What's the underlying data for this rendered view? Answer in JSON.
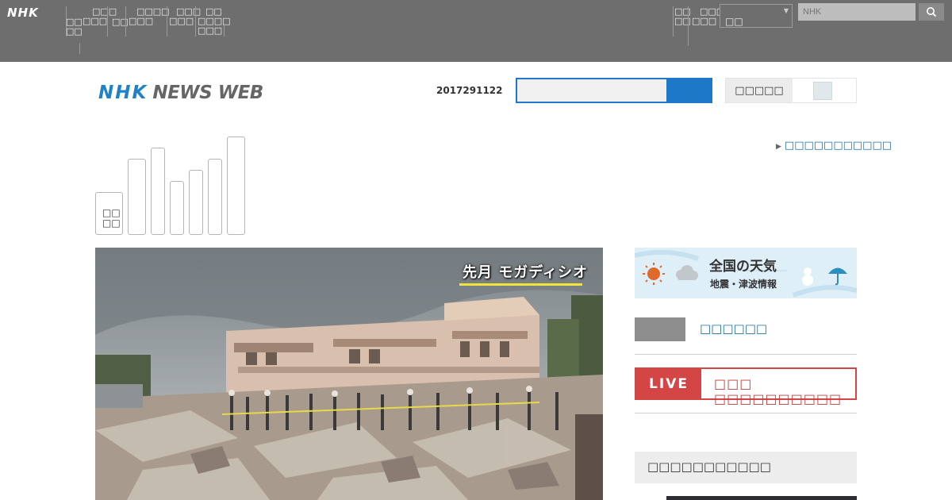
{
  "topbar": {
    "logo": "NHK",
    "nav": [
      [
        "□□",
        "□□"
      ],
      [
        "□□□",
        "□□□"
      ],
      [
        "□□"
      ],
      [
        "□□□□",
        "□□□"
      ],
      [
        "□□□",
        "□□□"
      ],
      [
        "□□",
        "□□□□",
        "□□□"
      ]
    ],
    "right_nav": [
      [
        "□□",
        "□□"
      ],
      [
        "□□□",
        "□□□"
      ]
    ],
    "language_select": "□□",
    "search_placeholder": "NHK"
  },
  "header": {
    "logo_part1": "NHK",
    "logo_part2": "NEWS WEB",
    "date": "2017291122",
    "switch_label": "□□□□□"
  },
  "categories": {
    "first_label": "□□ □□"
  },
  "more_link": "□□□□□□□□□□□",
  "photo": {
    "caption": "先月 モガディシオ"
  },
  "sidebar": {
    "weather_title": "全国の天気",
    "weather_subtitle": "地震・津波情報",
    "link1": "□□□□□□",
    "live_label": "LIVE",
    "live_text": "□□□ □□□□□□□□□□",
    "panel_heading": "□□□□□□□□□□□"
  },
  "colors": {
    "topbar_bg": "#6e6e6e",
    "brand_blue": "#1f82c7",
    "live_red": "#d44545",
    "link_blue": "#1e6e9a"
  }
}
